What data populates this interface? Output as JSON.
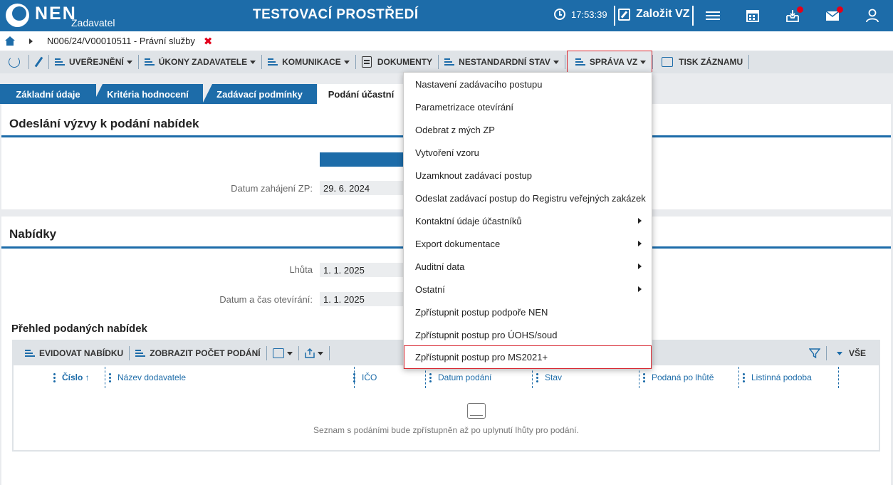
{
  "header": {
    "logo_text": "NEN",
    "logo_sub": "Zadavatel",
    "env_title": "TESTOVACÍ PROSTŘEDÍ",
    "clock": "17:53:39",
    "create_label": "Založit VZ",
    "icons": [
      "menu-icon",
      "calendar-icon",
      "inbox-icon",
      "mail-icon",
      "user-icon"
    ]
  },
  "breadcrumb": {
    "text": "N006/24/V00010511 - Právní služby",
    "close": "✖"
  },
  "toolbar": {
    "uverejneni": "UVEŘEJNĚNÍ",
    "ukony": "ÚKONY ZADAVATELE",
    "komunikace": "KOMUNIKACE",
    "dokumenty": "DOKUMENTY",
    "nestandardni": "NESTANDARDNÍ STAV",
    "sprava": "SPRÁVA VZ",
    "tisk": "TISK ZÁZNAMU"
  },
  "tabs": {
    "t1": "Základní údaje",
    "t2": "Kritéria hodnocení",
    "t3": "Zadávací podmínky",
    "t4": "Podání účastní"
  },
  "section1": {
    "title": "Odeslání výzvy k podání nabídek",
    "datum_label": "Datum zahájení ZP:",
    "datum_value": "29. 6. 2024"
  },
  "section2": {
    "title": "Nabídky",
    "lhuta_label": "Lhůta",
    "lhuta_value": "1. 1. 2025",
    "otevirani_label": "Datum a čas otevírání:",
    "otevirani_value": "1. 1. 2025"
  },
  "offers": {
    "title": "Přehled podaných nabídek",
    "evidovat": "EVIDOVAT NABÍDKU",
    "zobrazit": "ZOBRAZIT POČET PODÁNÍ",
    "filter_all": "VŠE",
    "columns": {
      "cislo": "Číslo ↑",
      "nazev": "Název dodavatele",
      "ico": "IČO",
      "datum": "Datum podání",
      "stav": "Stav",
      "podana": "Podaná po lhůtě",
      "listinna": "Listinná podoba"
    },
    "empty_text": "Seznam s podáními bude zpřístupněn až po uplynutí lhůty pro podání."
  },
  "dropdown": {
    "items": [
      "Nastavení zadávacího postupu",
      "Parametrizace otevírání",
      "Odebrat z mých ZP",
      "Vytvoření vzoru",
      "Uzamknout zadávací postup",
      "Odeslat zadávací postup do Registru veřejných zakázek",
      "Kontaktní údaje účastníků",
      "Export dokumentace",
      "Auditní data",
      "Ostatní",
      "Zpřístupnit postup podpoře NEN",
      "Zpřístupnit postup pro ÚOHS/soud",
      "Zpřístupnit postup pro MS2021+"
    ]
  },
  "colors": {
    "brand": "#1d6ca9",
    "highlight": "#d7262f",
    "badge": "#e3001b"
  }
}
